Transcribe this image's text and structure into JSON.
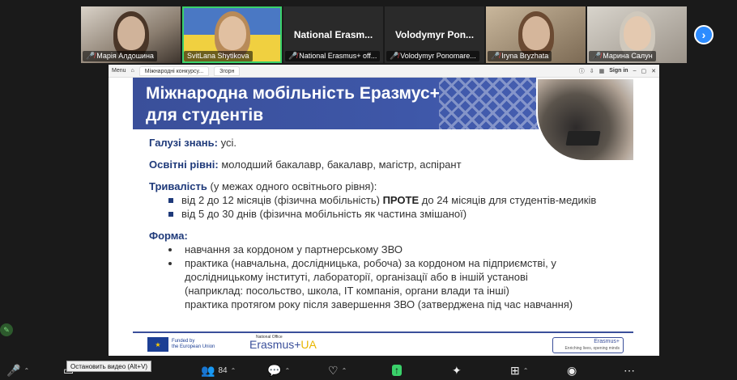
{
  "participants": [
    {
      "label": "Марія Алдошина",
      "big_name": "",
      "muted": true
    },
    {
      "label": "SvitLana Shytikova",
      "big_name": "",
      "muted": false
    },
    {
      "label": "National Erasmus+ off...",
      "big_name": "National Erasm...",
      "muted": true
    },
    {
      "label": "Volodymyr Ponomare...",
      "big_name": "Volodymyr Pon...",
      "muted": true
    },
    {
      "label": "Iryna Bryzhata",
      "big_name": "",
      "muted": true
    },
    {
      "label": "Марина Салун",
      "big_name": "",
      "muted": true
    }
  ],
  "next_page_icon": "chevron-right-icon",
  "browser": {
    "menu_label": "Menu",
    "tab_title": "Міжнародні конкурсу...",
    "new_tab_label": "Згорн",
    "signin_label": "Sign in"
  },
  "slide": {
    "title_line1": "Міжнародна мобільність Еразмус+",
    "title_line2": "для студентів",
    "fields_label": "Галузі знань:",
    "fields_value": "усі.",
    "levels_label": "Освітні рівні:",
    "levels_value": "молодший бакалавр, бакалавр, магістр, аспірант",
    "duration_label": "Тривалість",
    "duration_note": "(у межах одного освітнього рівня):",
    "duration_items": [
      {
        "pre": "від 2 до 12 місяців (фізична мобільність) ",
        "strong": "ПРОТЕ",
        "post": " до 24 місяців для студентів-медиків"
      },
      {
        "pre": "від 5 до 30 днів (фізична мобільність як частина змішаної)",
        "strong": "",
        "post": ""
      }
    ],
    "form_label": "Форма:",
    "form_item1": "навчання за кордоном у партнерському ЗВО",
    "form_item2_lines": [
      "практика (навчальна, дослідницька, робоча) за кордоном на підприємстві, у",
      "дослідницькому інституті, лабораторії, організації або в іншій установі",
      "(наприклад: посольство, школа, IT компанія, органи влади та інші)",
      "практика протягом року після завершення ЗВО (затверджена під час навчання)"
    ],
    "footer": {
      "eu_line1": "Funded by",
      "eu_line2": "the European Union",
      "national_office": "National Office",
      "erasmus_text": "Erasmus+",
      "ua_text": "UA",
      "box_title": "Erasmus+",
      "box_tagline": "Enriching lives, opening minds"
    }
  },
  "toolbar": {
    "tooltip": "Остановить видео (Alt+V)",
    "participants_count": "84"
  },
  "colors": {
    "banner": "#3e57a8",
    "accent_text": "#1f3a7a",
    "active_speaker": "#3ad16a",
    "zoom_blue": "#2d8cff"
  }
}
